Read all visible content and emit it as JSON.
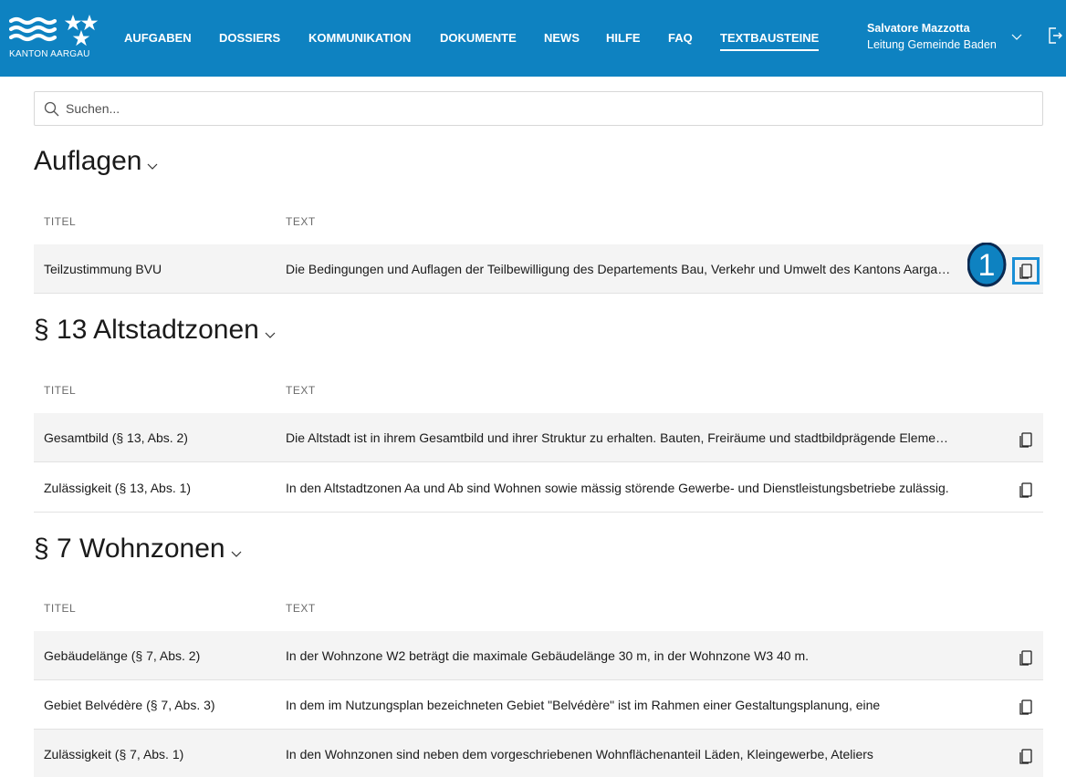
{
  "header": {
    "logo_text": "KANTON AARGAU",
    "nav": [
      {
        "label": "AUFGABEN"
      },
      {
        "label": "DOSSIERS"
      },
      {
        "label": "KOMMUNIKATION"
      },
      {
        "label": "DOKUMENTE"
      },
      {
        "label": "NEWS"
      },
      {
        "label": "HILFE"
      },
      {
        "label": "FAQ"
      },
      {
        "label": "TEXTBAUSTEINE",
        "active": true
      }
    ],
    "user_name": "Salvatore Mazzotta",
    "user_role": "Leitung Gemeinde Baden",
    "brand_color": "#0e82c1"
  },
  "search": {
    "placeholder": "Suchen...",
    "value": ""
  },
  "columns": {
    "title": "TITEL",
    "text": "TEXT"
  },
  "sections": [
    {
      "title": "Auflagen",
      "rows": [
        {
          "title": "Teilzustimmung BVU",
          "text": "Die Bedingungen und Auflagen der Teilbewilligung des Departements Bau, Verkehr und Umwelt des Kantons Aargau sind einzuhalten."
        }
      ]
    },
    {
      "title": "§ 13 Altstadtzonen",
      "rows": [
        {
          "title": "Gesamtbild (§ 13, Abs. 2)",
          "text": "Die Altstadt ist in ihrem Gesamtbild und ihrer Struktur zu erhalten. Bauten, Freiräume und stadtbildprägende Elemente"
        },
        {
          "title": "Zulässigkeit (§ 13, Abs. 1)",
          "text": "In den Altstadtzonen Aa und Ab sind Wohnen sowie mässig störende Gewerbe- und Dienstleistungsbetriebe zulässig."
        }
      ]
    },
    {
      "title": "§ 7 Wohnzonen",
      "rows": [
        {
          "title": "Gebäudelänge (§ 7, Abs. 2)",
          "text": "In der Wohnzone W2 beträgt die maximale Gebäudelänge 30 m, in der Wohnzone W3 40 m."
        },
        {
          "title": "Gebiet Belvédère (§ 7, Abs. 3)",
          "text": "In dem im Nutzungsplan bezeichneten Gebiet \"Belvédère\" ist im Rahmen einer Gestaltungsplanung, eine"
        },
        {
          "title": "Zulässigkeit (§ 7, Abs. 1)",
          "text": "In den Wohnzonen sind neben dem vorgeschriebenen Wohnflächenanteil Läden, Kleingewerbe, Ateliers"
        }
      ]
    }
  ],
  "annotation": {
    "marker_label": "1",
    "marker_color": "#0e82c1"
  },
  "icons": [
    "search-icon",
    "chevron-down-icon",
    "copy-icon",
    "logout-icon"
  ]
}
